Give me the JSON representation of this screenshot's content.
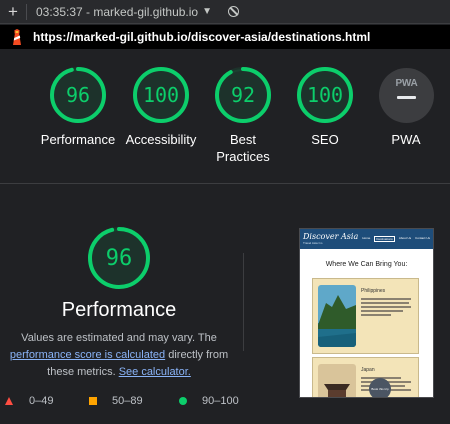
{
  "topbar": {
    "new_tab_label": "+",
    "timestamp_tab": "03:35:37 - marked-gil.github.io"
  },
  "urlbar": {
    "url": "https://marked-gil.github.io/discover-asia/destinations.html"
  },
  "categories": [
    {
      "label": "Performance",
      "score": "96"
    },
    {
      "label": "Accessibility",
      "score": "100"
    },
    {
      "label": "Best Practices",
      "score": "92",
      "line1": "Best",
      "line2": "Practices"
    },
    {
      "label": "SEO",
      "score": "100"
    },
    {
      "label": "PWA",
      "badge_text": "PWA"
    }
  ],
  "performance_detail": {
    "score": "96",
    "title": "Performance",
    "desc_part1": "Values are estimated and may vary. The",
    "link1": "performance score is calculated",
    "desc_part2": "directly from these metrics.",
    "link2": "See calculator."
  },
  "legend": {
    "fail": "0–49",
    "average": "50–89",
    "pass": "90–100"
  },
  "thumbnail": {
    "logo": "Discover Asia",
    "tagline": "Travel Asia Co",
    "nav": [
      "Home",
      "Destinations",
      "About Us",
      "Contact Us"
    ],
    "heading": "Where We Can Bring You:",
    "card1_title": "Philippines",
    "card2_title": "Japan",
    "book_button": "Book this trip"
  },
  "colors": {
    "pass": "#0cce6b",
    "average": "#ffa400",
    "fail": "#ff4e42",
    "link": "#8ab4f8",
    "background": "#202124"
  }
}
